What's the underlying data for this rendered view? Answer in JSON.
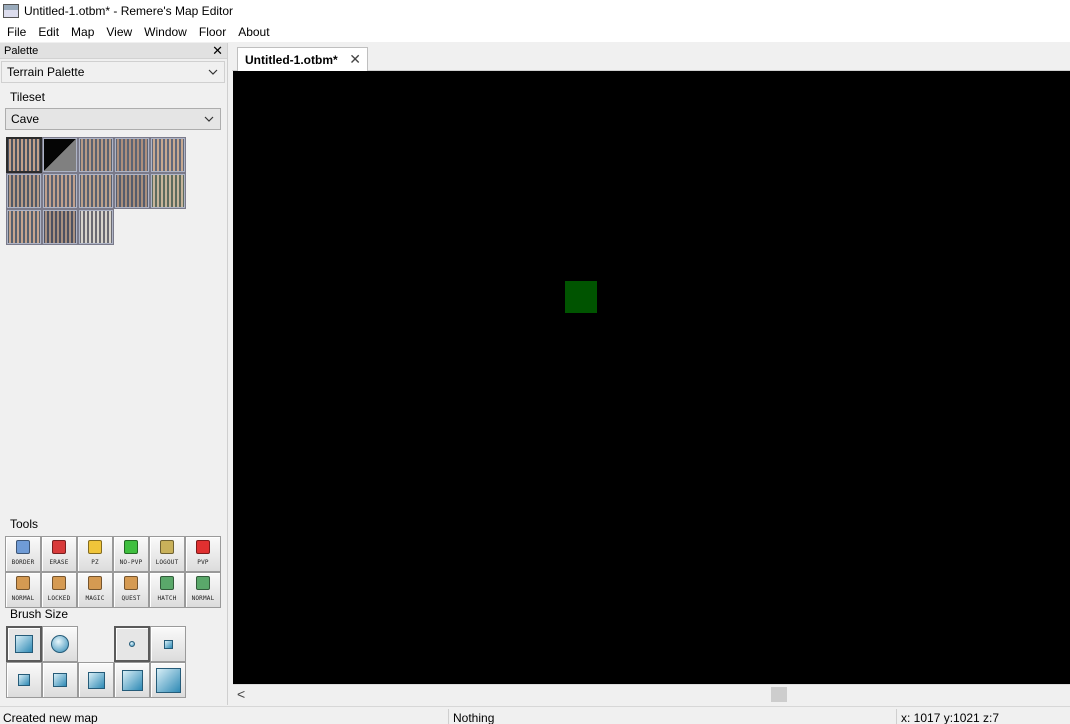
{
  "window": {
    "title": "Untitled-1.otbm* - Remere's Map Editor"
  },
  "menu": [
    "File",
    "Edit",
    "Map",
    "View",
    "Window",
    "Floor",
    "About"
  ],
  "palette": {
    "header": "Palette",
    "close_glyph": "✕",
    "selected_palette": "Terrain Palette",
    "tileset_group": "Tileset",
    "selected_tileset": "Cave",
    "tiles": [
      {
        "name": "cave-wall-1",
        "colors": [
          "#4a5260",
          "#c3a08a"
        ],
        "selected": true
      },
      {
        "name": "cave-dark",
        "colors": [
          "#050505",
          "#808080"
        ],
        "selected": false
      },
      {
        "name": "cave-wall-2",
        "colors": [
          "#5a6270",
          "#b79a85"
        ],
        "selected": false
      },
      {
        "name": "cave-wall-3",
        "colors": [
          "#5c6474",
          "#ae8f7c"
        ],
        "selected": false
      },
      {
        "name": "cave-wall-4",
        "colors": [
          "#60687a",
          "#c7a890"
        ],
        "selected": false
      },
      {
        "name": "cave-wall-5",
        "colors": [
          "#505866",
          "#b69a86"
        ],
        "selected": false
      },
      {
        "name": "cave-wall-6",
        "colors": [
          "#5a6070",
          "#c0a08c"
        ],
        "selected": false
      },
      {
        "name": "cave-wall-7",
        "colors": [
          "#586070",
          "#bba08a"
        ],
        "selected": false
      },
      {
        "name": "cave-wall-8",
        "colors": [
          "#545c6c",
          "#a88e7c"
        ],
        "selected": false
      },
      {
        "name": "cave-wall-9",
        "colors": [
          "#5c6a5e",
          "#c7b49a"
        ],
        "selected": false
      },
      {
        "name": "cave-wall-10",
        "colors": [
          "#56606e",
          "#c6a58e"
        ],
        "selected": false
      },
      {
        "name": "cave-wall-11",
        "colors": [
          "#4c5060",
          "#a89080"
        ],
        "selected": false
      },
      {
        "name": "cave-wall-12",
        "colors": [
          "#6a6a72",
          "#d8d4cc"
        ],
        "selected": false
      }
    ],
    "tools_group": "Tools",
    "tools": [
      {
        "label": "BORDER",
        "icon": "border-icon",
        "color": "#6f9bd6"
      },
      {
        "label": "ERASE",
        "icon": "erase-icon",
        "color": "#d83a3a"
      },
      {
        "label": "PZ",
        "icon": "pz-icon",
        "color": "#f0c53a"
      },
      {
        "label": "NO-PVP",
        "icon": "no-pvp-icon",
        "color": "#3fbf3f"
      },
      {
        "label": "LOGOUT",
        "icon": "logout-icon",
        "color": "#c9b15a"
      },
      {
        "label": "PVP",
        "icon": "pvp-icon",
        "color": "#e03030"
      },
      {
        "label": "NORMAL",
        "icon": "door-normal-icon",
        "color": "#d59a52"
      },
      {
        "label": "LOCKED",
        "icon": "door-locked-icon",
        "color": "#d59a52"
      },
      {
        "label": "MAGIC",
        "icon": "door-magic-icon",
        "color": "#d59a52"
      },
      {
        "label": "QUEST",
        "icon": "door-quest-icon",
        "color": "#d59a52"
      },
      {
        "label": "HATCH",
        "icon": "hatch-icon",
        "color": "#5aa86a"
      },
      {
        "label": "NORMAL",
        "icon": "window-normal-icon",
        "color": "#5aa86a"
      }
    ],
    "brush_group": "Brush Size"
  },
  "editor": {
    "tab_title": "Untitled-1.otbm*",
    "tab_close_glyph": "✕",
    "scroll_left_glyph": "<"
  },
  "status": {
    "message": "Created new map",
    "hover": "Nothing",
    "position": "x: 1017 y:1021 z:7"
  }
}
